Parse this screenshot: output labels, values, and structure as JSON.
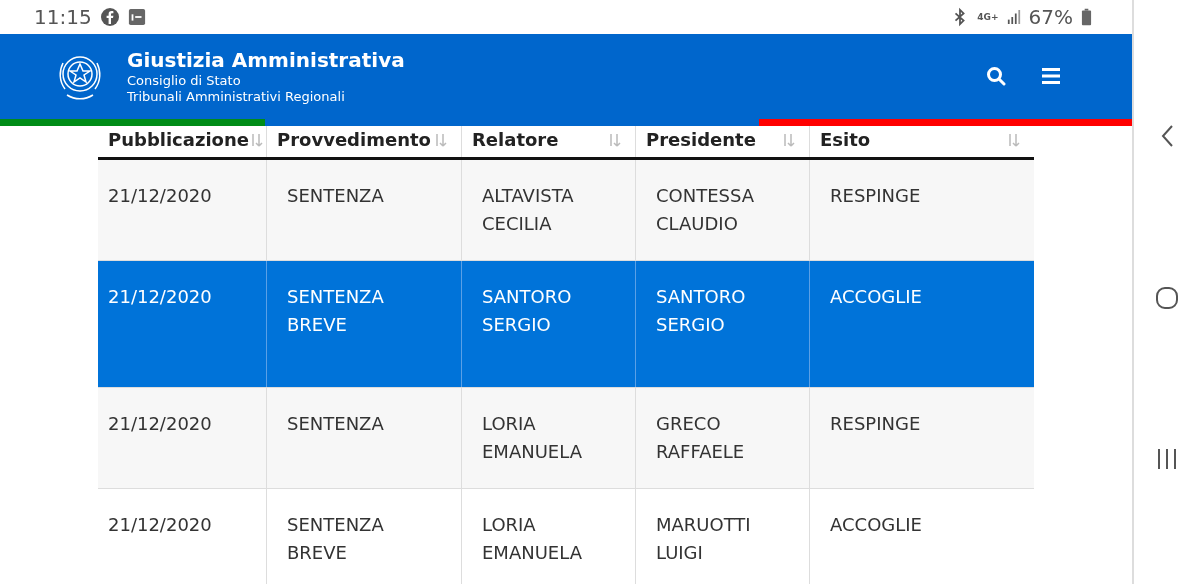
{
  "status_bar": {
    "time": "11:15",
    "network": "4G+",
    "battery": "67%"
  },
  "header": {
    "title": "Giustizia Amministrativa",
    "subtitle_1": "Consiglio di Stato",
    "subtitle_2": "Tribunali Amministrativi Regionali"
  },
  "table": {
    "columns": [
      "Pubblicazione",
      "Provvedimento",
      "Relatore",
      "Presidente",
      "Esito"
    ],
    "rows": [
      {
        "selected": false,
        "cells": [
          "21/12/2020",
          "SENTENZA",
          "ALTAVISTA CECILIA",
          "CONTESSA CLAUDIO",
          "RESPINGE"
        ]
      },
      {
        "selected": true,
        "cells": [
          "21/12/2020",
          "SENTENZA BREVE",
          "SANTORO SERGIO",
          "SANTORO SERGIO",
          "ACCOGLIE"
        ]
      },
      {
        "selected": false,
        "cells": [
          "21/12/2020",
          "SENTENZA",
          "LORIA EMANUELA",
          "GRECO RAFFAELE",
          "RESPINGE"
        ]
      },
      {
        "selected": false,
        "cells": [
          "21/12/2020",
          "SENTENZA BREVE",
          "LORIA EMANUELA",
          "MARUOTTI LUIGI",
          "ACCOGLIE"
        ]
      }
    ]
  }
}
